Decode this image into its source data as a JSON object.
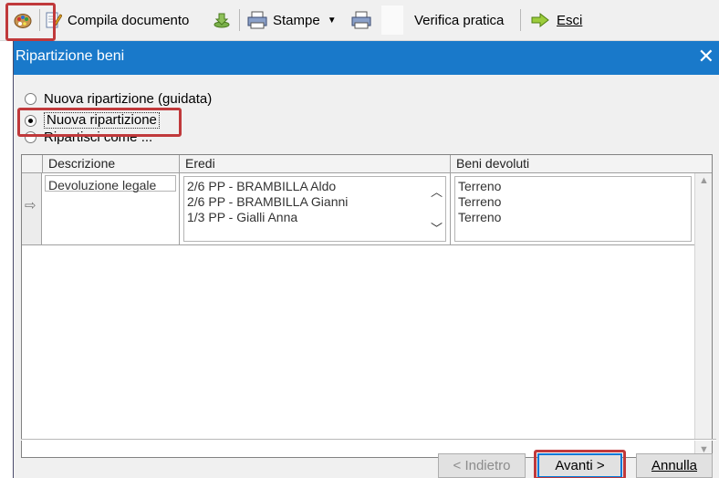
{
  "toolbar": {
    "compila_label": "Compila documento",
    "stampe_label": "Stampe",
    "verifica_label": "Verifica pratica",
    "esci_label": "Esci"
  },
  "dialog": {
    "title": "Ripartizione beni",
    "close_glyph": "✕",
    "options": [
      {
        "label": "Nuova ripartizione (guidata)",
        "selected": false
      },
      {
        "label": "Nuova ripartizione",
        "selected": true
      },
      {
        "label": "Ripartisci come ...",
        "selected": false
      }
    ],
    "grid": {
      "columns": [
        "Descrizione",
        "Eredi",
        "Beni devoluti"
      ],
      "row_marker": "⇨",
      "rows": [
        {
          "descrizione": "Devoluzione legale",
          "eredi": [
            "2/6 PP - BRAMBILLA Aldo",
            "2/6 PP - BRAMBILLA Gianni",
            "1/3 PP - Gialli Anna"
          ],
          "beni": [
            "Terreno",
            "Terreno",
            "Terreno"
          ]
        }
      ]
    },
    "buttons": {
      "back": "< Indietro",
      "next": "Avanti >",
      "cancel": "Annulla"
    }
  },
  "colors": {
    "titlebar": "#1979ca",
    "highlight": "#c0393b"
  }
}
